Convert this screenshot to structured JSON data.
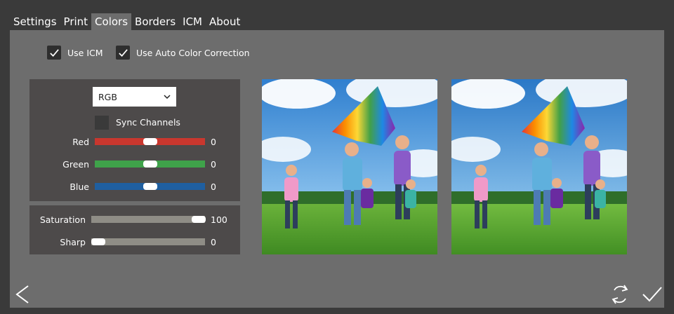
{
  "tabs": [
    {
      "label": "Settings"
    },
    {
      "label": "Print"
    },
    {
      "label": "Colors"
    },
    {
      "label": "Borders"
    },
    {
      "label": "ICM"
    },
    {
      "label": "About"
    }
  ],
  "active_tab": "Colors",
  "options": {
    "use_icm": {
      "label": "Use ICM",
      "checked": true
    },
    "auto_color": {
      "label": "Use Auto Color Correction",
      "checked": true
    }
  },
  "channel_select": {
    "value": "RGB"
  },
  "sync_channels": {
    "label": "Sync Channels",
    "checked": false
  },
  "channels": [
    {
      "label": "Red",
      "value": "0",
      "color": "#c9372e"
    },
    {
      "label": "Green",
      "value": "0",
      "color": "#3fa24a"
    },
    {
      "label": "Blue",
      "value": "0",
      "color": "#1f5fa0"
    }
  ],
  "adjust": [
    {
      "label": "Saturation",
      "value": "100"
    },
    {
      "label": "Sharp",
      "value": "0"
    }
  ],
  "icons": {
    "back": "chevron-left-icon",
    "reset": "refresh-icon",
    "confirm": "checkmark-icon"
  }
}
